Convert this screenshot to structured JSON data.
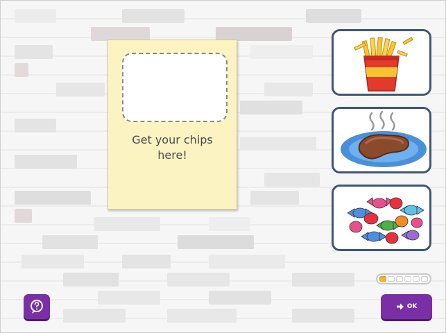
{
  "poster": {
    "text": "Get your chips\nhere!"
  },
  "options": [
    {
      "icon": "chips-icon"
    },
    {
      "icon": "steak-icon"
    },
    {
      "icon": "sweets-icon"
    }
  ],
  "progress": {
    "current": 1,
    "total": 6
  },
  "buttons": {
    "help_icon": "question-icon",
    "ok_label": "OK",
    "ok_icon": "arrow-right-icon"
  },
  "colors": {
    "button": "#7b2fa6",
    "card_border": "#3f5574",
    "poster": "#fbf3c2",
    "progress_fill": "#f2b233"
  }
}
